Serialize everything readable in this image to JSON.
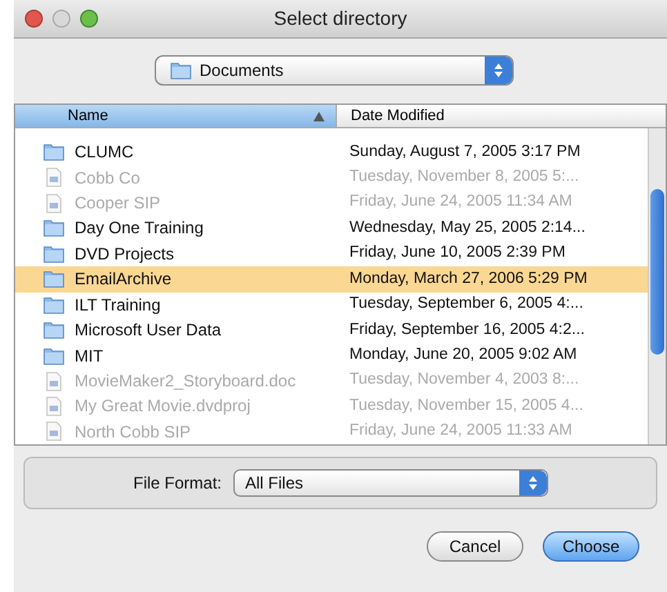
{
  "window": {
    "title": "Select directory"
  },
  "location_popup": {
    "value": "Documents"
  },
  "table": {
    "columns": [
      {
        "label": "Name",
        "sorted": true
      },
      {
        "label": "Date Modified",
        "sorted": false
      }
    ],
    "rows": [
      {
        "name": "CLUMC",
        "date": "Sunday, August 7, 2005 3:17 PM",
        "kind": "folder",
        "disabled": false,
        "selected": false
      },
      {
        "name": "Cobb Co",
        "date": "Tuesday, November 8, 2005 5:...",
        "kind": "file",
        "disabled": true,
        "selected": false
      },
      {
        "name": "Cooper SIP",
        "date": "Friday, June 24, 2005 11:34 AM",
        "kind": "file",
        "disabled": true,
        "selected": false
      },
      {
        "name": "Day One Training",
        "date": "Wednesday, May 25, 2005 2:14...",
        "kind": "folder",
        "disabled": false,
        "selected": false
      },
      {
        "name": "DVD Projects",
        "date": "Friday, June 10, 2005 2:39 PM",
        "kind": "folder",
        "disabled": false,
        "selected": false
      },
      {
        "name": "EmailArchive",
        "date": "Monday, March 27, 2006 5:29 PM",
        "kind": "folder",
        "disabled": false,
        "selected": true
      },
      {
        "name": "ILT Training",
        "date": "Tuesday, September 6, 2005 4:...",
        "kind": "folder",
        "disabled": false,
        "selected": false
      },
      {
        "name": "Microsoft User Data",
        "date": "Friday, September 16, 2005 4:2...",
        "kind": "folder",
        "disabled": false,
        "selected": false
      },
      {
        "name": "MIT",
        "date": "Monday, June 20, 2005 9:02 AM",
        "kind": "folder",
        "disabled": false,
        "selected": false
      },
      {
        "name": "MovieMaker2_Storyboard.doc",
        "date": "Tuesday, November 4, 2003 8:...",
        "kind": "file",
        "disabled": true,
        "selected": false
      },
      {
        "name": "My Great Movie.dvdproj",
        "date": "Tuesday, November 15, 2005 4...",
        "kind": "file",
        "disabled": true,
        "selected": false
      },
      {
        "name": "North Cobb SIP",
        "date": "Friday, June 24, 2005 11:33 AM",
        "kind": "file",
        "disabled": true,
        "selected": false
      }
    ]
  },
  "file_format": {
    "label": "File Format:",
    "value": "All Files"
  },
  "buttons": [
    {
      "label": "Cancel",
      "default": false
    },
    {
      "label": "Choose",
      "default": true
    }
  ]
}
